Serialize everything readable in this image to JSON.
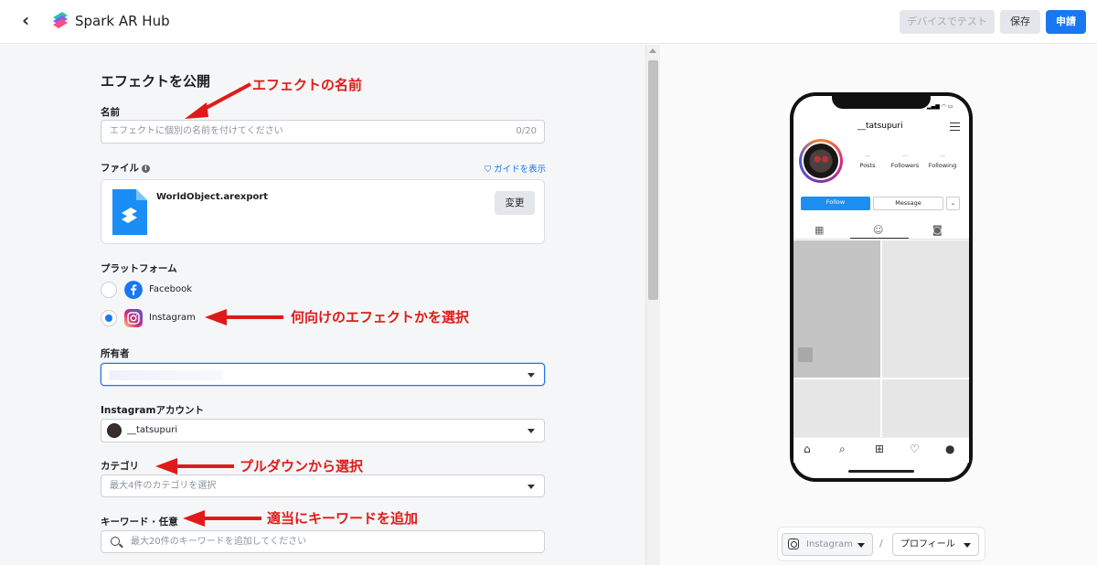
{
  "header": {
    "brand": "Spark AR Hub",
    "test_button": "デバイスでテスト",
    "save_button": "保存",
    "submit_button": "申請"
  },
  "form": {
    "title": "エフェクトを公開",
    "name": {
      "label": "名前",
      "placeholder": "エフェクトに個別の名前を付けてください",
      "counter": "0/20"
    },
    "file": {
      "label": "ファイル",
      "guide_link": "ガイドを表示",
      "file_name": "WorldObject.arexport",
      "change_button": "変更"
    },
    "platform": {
      "label": "プラットフォーム",
      "options": [
        {
          "label": "Facebook",
          "selected": false
        },
        {
          "label": "Instagram",
          "selected": true
        }
      ]
    },
    "owner": {
      "label": "所有者"
    },
    "instagram_account": {
      "label": "Instagramアカウント",
      "value": "__tatsupuri"
    },
    "category": {
      "label": "カテゴリ",
      "placeholder": "最大4件のカテゴリを選択"
    },
    "keywords": {
      "label": "キーワード · 任意",
      "placeholder": "最大20件のキーワードを追加してください"
    }
  },
  "annotations": {
    "name_note": "エフェクトの名前",
    "platform_note": "何向けのエフェクトかを選択",
    "category_note": "プルダウンから選択",
    "keyword_note": "適当にキーワードを追加"
  },
  "preview": {
    "username": "__tatsupuri",
    "stats": [
      {
        "value": "—",
        "label": "Posts"
      },
      {
        "value": "—",
        "label": "Followers"
      },
      {
        "value": "—",
        "label": "Following"
      }
    ],
    "follow_button": "Follow",
    "message_button": "Message",
    "more_glyph": "⌄",
    "platform_select": "Instagram",
    "view_select": "プロフィール",
    "separator": "/"
  },
  "colors": {
    "accent": "#1877f2",
    "annotation": "#e01a1a"
  }
}
